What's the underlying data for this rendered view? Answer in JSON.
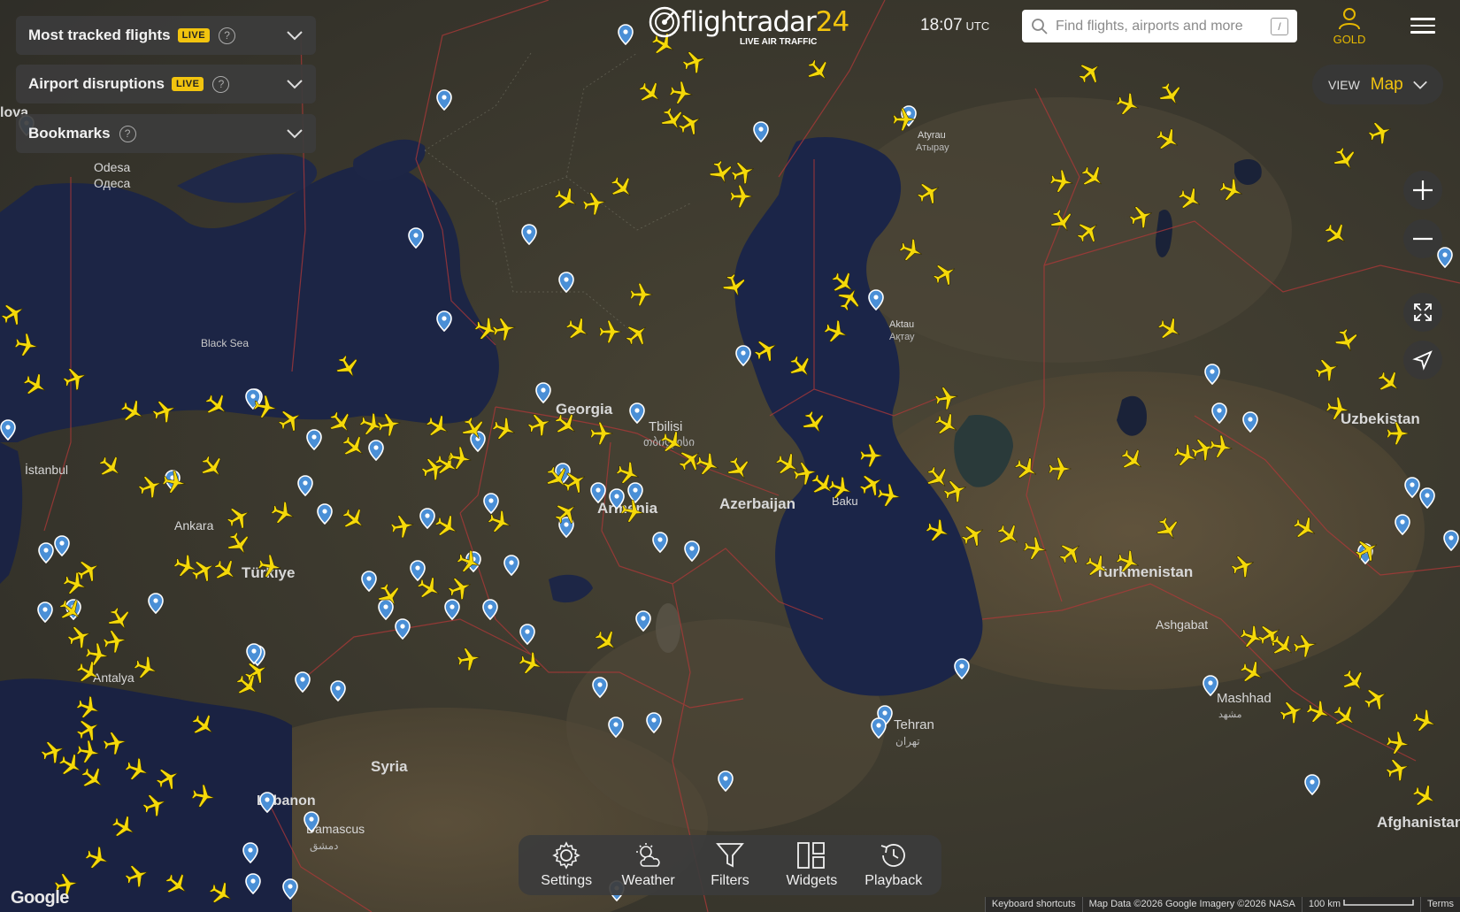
{
  "panels": {
    "most_tracked": {
      "title": "Most tracked flights",
      "badge": "LIVE",
      "help": "?"
    },
    "airport_disruptions": {
      "title": "Airport disruptions",
      "badge": "LIVE",
      "help": "?"
    },
    "bookmarks": {
      "title": "Bookmarks",
      "help": "?"
    }
  },
  "header": {
    "logo_main": "flightradar",
    "logo_num": "24",
    "logo_tagline": "LIVE AIR TRAFFIC",
    "time": "18:07",
    "time_zone": "UTC",
    "search_placeholder": "Find flights, airports and more",
    "search_shortcut": "/",
    "account_label": "GOLD"
  },
  "view": {
    "label": "VIEW",
    "value": "Map"
  },
  "bottom_bar": {
    "settings": "Settings",
    "weather": "Weather",
    "filters": "Filters",
    "widgets": "Widgets",
    "playback": "Playback"
  },
  "footer": {
    "google": "Google",
    "keyboard_shortcuts": "Keyboard shortcuts",
    "map_data": "Map Data ©2026 Google Imagery ©2026 NASA",
    "scale": "100 km",
    "terms": "Terms"
  },
  "map_labels": {
    "black_sea": "Black Sea",
    "georgia": "Georgia",
    "tbilisi": "Tbilisi",
    "armenia": "Armenia",
    "azerbaijan": "Azerbaijan",
    "turkiye": "Türkiye",
    "ankara": "Ankara",
    "istanbul": "İstanbul",
    "antalya": "Antalya",
    "syria": "Syria",
    "lebanon": "Lebanon",
    "damascus": "Damascus",
    "damascus_ar": "دمشق",
    "tehran": "Tehran",
    "tehran_fa": "تهران",
    "mashhad": "Mashhad",
    "mashhad_fa": "مشهد",
    "turkmenistan": "Turkmenistan",
    "ashgabat": "Ashgabat",
    "uzbekistan": "Uzbekistan",
    "afghanistan": "Afghanistan",
    "odesa": "Odesa",
    "odesa_uk": "Одеса",
    "atyrau": "Atyrau",
    "atyrau_kz": "Атырау",
    "aktau": "Aktau",
    "aktau_kz": "Ақтау",
    "moldova": "lova",
    "baku": "Baku",
    "tbilisi_ka": "თბილისი"
  },
  "colors": {
    "aircraft": "#f5d90a",
    "accent": "#f2c40f",
    "airport_pin": "#4a90d9",
    "sea": "#1c2340",
    "land": "#3a3830",
    "border": "#b03838"
  }
}
